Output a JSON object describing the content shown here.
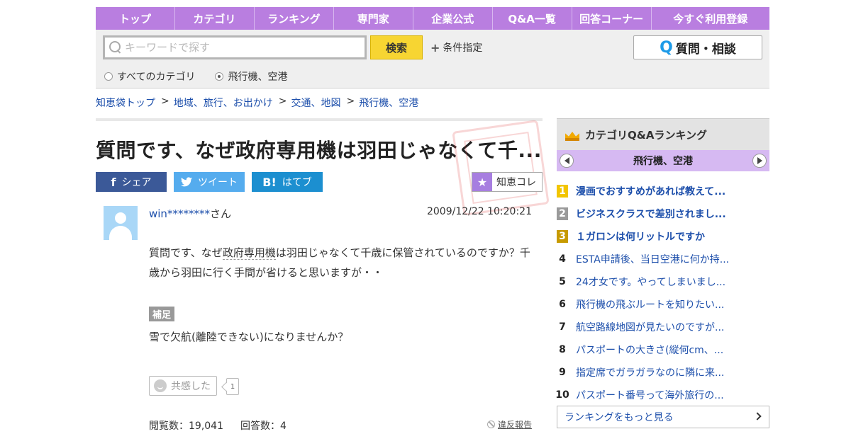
{
  "nav": {
    "items": [
      "トップ",
      "カテゴリ",
      "ランキング",
      "専門家",
      "企業公式",
      "Q&A一覧",
      "回答コーナー",
      "今すぐ利用登録"
    ]
  },
  "search": {
    "placeholder": "キーワードで探す",
    "button": "検索",
    "condition": "条件指定",
    "ask_button": "質問・相談",
    "ask_icon": "Q",
    "radio_all": "すべてのカテゴリ",
    "radio_category": "飛行機、空港",
    "selected": "飛行機、空港"
  },
  "breadcrumb": {
    "items": [
      "知恵袋トップ",
      "地域、旅行、お出かけ",
      "交通、地図",
      "飛行機、空港"
    ],
    "sep": ">"
  },
  "question": {
    "title": "質問です、なぜ政府専用機は羽田じゃなくて千...",
    "user": "win********",
    "user_suffix": "さん",
    "date": "2009/12/22  10:20:21",
    "body_pre": "質問です、なぜ",
    "body_kw": "政府専用機",
    "body_post": "は羽田じゃなくて千歳に保管されているのですか？千歳から羽田に行く手間が省けると思いますが・・",
    "supplement_label": "補足",
    "supplement": "雪で欠航(離陸できない)になりませんか？",
    "empathy_label": "共感した",
    "empathy_count": "1",
    "views_label": "閲覧数：19,041",
    "answers_label": "回答数：4",
    "report": "違反報告"
  },
  "share": {
    "facebook": "シェア",
    "facebook_icon": "f",
    "twitter": "ツイート",
    "hatena": "はてブ",
    "hatena_icon": "B!",
    "chiekore": "知恵コレ"
  },
  "sidebar": {
    "title": "カテゴリQ&Aランキング",
    "category": "飛行機、空港",
    "ranks": [
      {
        "n": "1",
        "text": "漫画でおすすめがあれば教えて..."
      },
      {
        "n": "2",
        "text": "ビジネスクラスで差別されまし..."
      },
      {
        "n": "3",
        "text": "１ガロンは何リットルですか"
      },
      {
        "n": "4",
        "text": "ESTA申請後、当日空港に何か持..."
      },
      {
        "n": "5",
        "text": "24才女です。やってしまいまし..."
      },
      {
        "n": "6",
        "text": "飛行機の飛ぶルートを知りたい..."
      },
      {
        "n": "7",
        "text": "航空路線地図が見たいのですが..."
      },
      {
        "n": "8",
        "text": "パスポートの大きさ(縦何cm、..."
      },
      {
        "n": "9",
        "text": "指定席でガラガラなのに隣に来..."
      },
      {
        "n": "10",
        "text": "パスポート番号って海外旅行の..."
      }
    ],
    "more": "ランキングをもっと見る"
  },
  "colors": {
    "nav_bg": "#b97ee0",
    "link": "#1d4fab",
    "search_button": "#f7d532",
    "facebook": "#3b5998",
    "twitter": "#55acee",
    "hatena": "#1c8fd0"
  }
}
